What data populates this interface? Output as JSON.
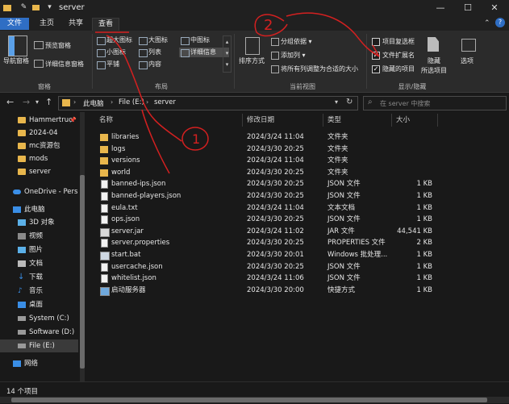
{
  "window": {
    "title": "server"
  },
  "tabs": [
    {
      "label": "文件"
    },
    {
      "label": "主页"
    },
    {
      "label": "共享"
    },
    {
      "label": "查看"
    }
  ],
  "ribbon": {
    "panes": {
      "nav_pane": "导航窗格",
      "preview_pane": "预览窗格",
      "details_pane": "详细信息窗格",
      "group": "窗格"
    },
    "layout": {
      "items": [
        "超大图标",
        "大图标",
        "中图标",
        "小图标",
        "列表",
        "详细信息",
        "平铺",
        "内容"
      ],
      "group": "布局"
    },
    "current_view": {
      "sort": "排序方式",
      "group_by": "分组依据",
      "add_column": "添加列",
      "fit_columns": "将所有列调整为合适的大小",
      "group": "当前视图"
    },
    "show_hide": {
      "item_checkboxes": "项目复选框",
      "file_extensions": "文件扩展名",
      "hidden_items": "隐藏的项目",
      "item_checkboxes_checked": false,
      "file_extensions_checked": true,
      "hidden_items_checked": true,
      "hide_selected": "隐藏",
      "hide_selected_2": "所选项目",
      "options": "选项",
      "group": "显示/隐藏"
    }
  },
  "address": {
    "crumbs": [
      "此电脑",
      "File (E:)",
      "server"
    ],
    "search_placeholder": "在 server 中搜索"
  },
  "nav": [
    {
      "label": "Hammertruc",
      "type": "folder"
    },
    {
      "label": "2024-04",
      "type": "folder"
    },
    {
      "label": "mc资源包",
      "type": "folder"
    },
    {
      "label": "mods",
      "type": "folder"
    },
    {
      "label": "server",
      "type": "folder"
    },
    {
      "label": "OneDrive - Pers",
      "type": "cloud"
    },
    {
      "label": "此电脑",
      "type": "pc"
    },
    {
      "label": "3D 对象",
      "type": "3d"
    },
    {
      "label": "视频",
      "type": "video"
    },
    {
      "label": "图片",
      "type": "picture"
    },
    {
      "label": "文档",
      "type": "doc"
    },
    {
      "label": "下载",
      "type": "download"
    },
    {
      "label": "音乐",
      "type": "music"
    },
    {
      "label": "桌面",
      "type": "desktop"
    },
    {
      "label": "System (C:)",
      "type": "drive"
    },
    {
      "label": "Software (D:)",
      "type": "drive"
    },
    {
      "label": "File (E:)",
      "type": "drive"
    },
    {
      "label": "网络",
      "type": "network"
    }
  ],
  "columns": {
    "name": "名称",
    "date": "修改日期",
    "type": "类型",
    "size": "大小"
  },
  "files": [
    {
      "name": "libraries",
      "date": "2024/3/24 11:04",
      "type": "文件夹",
      "size": "",
      "icon": "folder"
    },
    {
      "name": "logs",
      "date": "2024/3/30 20:25",
      "type": "文件夹",
      "size": "",
      "icon": "folder"
    },
    {
      "name": "versions",
      "date": "2024/3/24 11:04",
      "type": "文件夹",
      "size": "",
      "icon": "folder"
    },
    {
      "name": "world",
      "date": "2024/3/30 20:25",
      "type": "文件夹",
      "size": "",
      "icon": "folder"
    },
    {
      "name": "banned-ips.json",
      "date": "2024/3/30 20:25",
      "type": "JSON 文件",
      "size": "1 KB",
      "icon": "doc"
    },
    {
      "name": "banned-players.json",
      "date": "2024/3/30 20:25",
      "type": "JSON 文件",
      "size": "1 KB",
      "icon": "doc"
    },
    {
      "name": "eula.txt",
      "date": "2024/3/24 11:04",
      "type": "文本文档",
      "size": "1 KB",
      "icon": "doc"
    },
    {
      "name": "ops.json",
      "date": "2024/3/30 20:25",
      "type": "JSON 文件",
      "size": "1 KB",
      "icon": "doc"
    },
    {
      "name": "server.jar",
      "date": "2024/3/24 11:02",
      "type": "JAR 文件",
      "size": "44,541 KB",
      "icon": "jar"
    },
    {
      "name": "server.properties",
      "date": "2024/3/30 20:25",
      "type": "PROPERTIES 文件",
      "size": "2 KB",
      "icon": "doc"
    },
    {
      "name": "start.bat",
      "date": "2024/3/30 20:01",
      "type": "Windows 批处理...",
      "size": "1 KB",
      "icon": "bat"
    },
    {
      "name": "usercache.json",
      "date": "2024/3/30 20:25",
      "type": "JSON 文件",
      "size": "1 KB",
      "icon": "doc"
    },
    {
      "name": "whitelist.json",
      "date": "2024/3/24 11:06",
      "type": "JSON 文件",
      "size": "1 KB",
      "icon": "doc"
    },
    {
      "name": "启动服务器",
      "date": "2024/3/30 20:00",
      "type": "快捷方式",
      "size": "1 KB",
      "icon": "shortcut"
    }
  ],
  "status": {
    "count": "14 个项目"
  },
  "annotations": {
    "one": "1",
    "two": "2"
  },
  "colors": {
    "accent": "#2f6ec4",
    "folder": "#e8b64c",
    "annotation": "#d42020"
  }
}
